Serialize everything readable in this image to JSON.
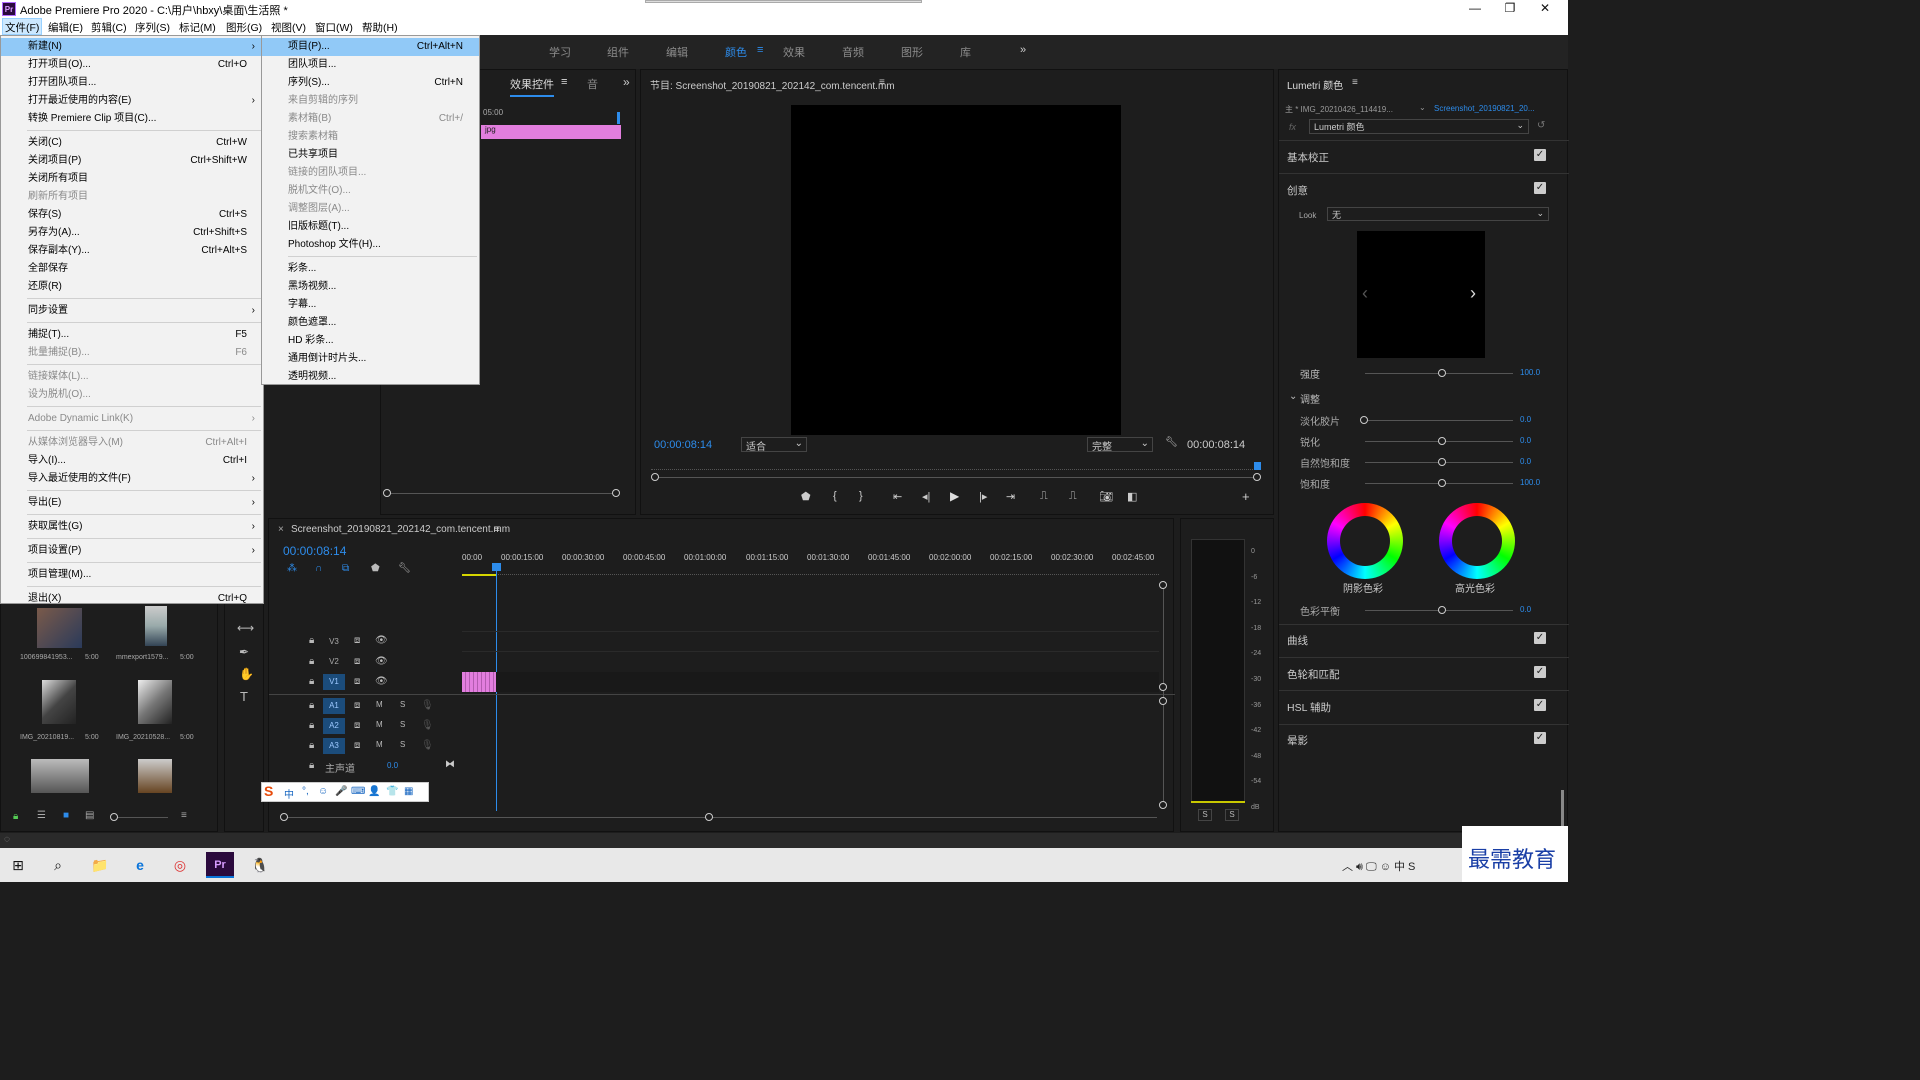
{
  "window": {
    "title": "Adobe Premiere Pro 2020 - C:\\用户\\hbxy\\桌面\\生活照 *",
    "app_icon": "Pr"
  },
  "menubar": [
    "文件(F)",
    "编辑(E)",
    "剪辑(C)",
    "序列(S)",
    "标记(M)",
    "图形(G)",
    "视图(V)",
    "窗口(W)",
    "帮助(H)"
  ],
  "workspaces": {
    "items": [
      "学习",
      "组件",
      "编辑",
      "颜色",
      "效果",
      "音频",
      "图形",
      "库"
    ],
    "active": "颜色",
    "more": "»"
  },
  "file_menu": [
    {
      "label": "新建(N)",
      "shortcut": "",
      "arrow": true,
      "disabled": false,
      "highlight": true
    },
    {
      "label": "打开项目(O)...",
      "shortcut": "Ctrl+O"
    },
    {
      "label": "打开团队项目...",
      "shortcut": ""
    },
    {
      "label": "打开最近使用的内容(E)",
      "shortcut": "",
      "arrow": true
    },
    {
      "label": "转换 Premiere Clip 项目(C)...",
      "shortcut": ""
    },
    {
      "sep": true
    },
    {
      "label": "关闭(C)",
      "shortcut": "Ctrl+W"
    },
    {
      "label": "关闭项目(P)",
      "shortcut": "Ctrl+Shift+W"
    },
    {
      "label": "关闭所有项目",
      "shortcut": ""
    },
    {
      "label": "刷新所有项目",
      "shortcut": "",
      "disabled": true
    },
    {
      "label": "保存(S)",
      "shortcut": "Ctrl+S"
    },
    {
      "label": "另存为(A)...",
      "shortcut": "Ctrl+Shift+S"
    },
    {
      "label": "保存副本(Y)...",
      "shortcut": "Ctrl+Alt+S"
    },
    {
      "label": "全部保存",
      "shortcut": ""
    },
    {
      "label": "还原(R)",
      "shortcut": ""
    },
    {
      "sep": true
    },
    {
      "label": "同步设置",
      "shortcut": "",
      "arrow": true
    },
    {
      "sep": true
    },
    {
      "label": "捕捉(T)...",
      "shortcut": "F5"
    },
    {
      "label": "批量捕捉(B)...",
      "shortcut": "F6",
      "disabled": true
    },
    {
      "sep": true
    },
    {
      "label": "链接媒体(L)...",
      "shortcut": "",
      "disabled": true
    },
    {
      "label": "设为脱机(O)...",
      "shortcut": "",
      "disabled": true
    },
    {
      "sep": true
    },
    {
      "label": "Adobe Dynamic Link(K)",
      "shortcut": "",
      "arrow": true,
      "disabled": true
    },
    {
      "sep": true
    },
    {
      "label": "从媒体浏览器导入(M)",
      "shortcut": "Ctrl+Alt+I",
      "disabled": true
    },
    {
      "label": "导入(I)...",
      "shortcut": "Ctrl+I"
    },
    {
      "label": "导入最近使用的文件(F)",
      "shortcut": "",
      "arrow": true
    },
    {
      "sep": true
    },
    {
      "label": "导出(E)",
      "shortcut": "",
      "arrow": true
    },
    {
      "sep": true
    },
    {
      "label": "获取属性(G)",
      "shortcut": "",
      "arrow": true
    },
    {
      "sep": true
    },
    {
      "label": "项目设置(P)",
      "shortcut": "",
      "arrow": true
    },
    {
      "sep": true
    },
    {
      "label": "项目管理(M)...",
      "shortcut": ""
    },
    {
      "sep": true
    },
    {
      "label": "退出(X)",
      "shortcut": "Ctrl+Q"
    }
  ],
  "new_submenu": [
    {
      "label": "项目(P)...",
      "shortcut": "Ctrl+Alt+N",
      "highlight": true
    },
    {
      "label": "团队项目...",
      "shortcut": ""
    },
    {
      "label": "序列(S)...",
      "shortcut": "Ctrl+N"
    },
    {
      "label": "来自剪辑的序列",
      "shortcut": "",
      "disabled": true
    },
    {
      "label": "素材箱(B)",
      "shortcut": "Ctrl+/",
      "disabled": true
    },
    {
      "label": "搜索素材箱",
      "shortcut": "",
      "disabled": true
    },
    {
      "label": "已共享项目",
      "shortcut": ""
    },
    {
      "label": "链接的团队项目...",
      "shortcut": "",
      "disabled": true
    },
    {
      "label": "脱机文件(O)...",
      "shortcut": "",
      "disabled": true
    },
    {
      "label": "调整图层(A)...",
      "shortcut": "",
      "disabled": true
    },
    {
      "label": "旧版标题(T)...",
      "shortcut": ""
    },
    {
      "label": "Photoshop 文件(H)...",
      "shortcut": ""
    },
    {
      "sep": true
    },
    {
      "label": "彩条...",
      "shortcut": ""
    },
    {
      "label": "黑场视频...",
      "shortcut": ""
    },
    {
      "label": "字幕...",
      "shortcut": ""
    },
    {
      "label": "颜色遮罩...",
      "shortcut": ""
    },
    {
      "label": "HD 彩条...",
      "shortcut": ""
    },
    {
      "label": "通用倒计时片头...",
      "shortcut": ""
    },
    {
      "label": "透明视频...",
      "shortcut": ""
    }
  ],
  "effect_controls": {
    "tab": "效果控件",
    "tab2": "音",
    "time": "05:00",
    "clip": "jpg"
  },
  "program_monitor": {
    "title": "节目: Screenshot_20190821_202142_com.tencent.mm",
    "timecode_left": "00:00:08:14",
    "fit": "适合",
    "quality": "完整",
    "timecode_right": "00:00:08:14"
  },
  "lumetri": {
    "title": "Lumetri 颜色",
    "master": "主 * IMG_20210426_114419...",
    "clip": "Screenshot_20190821_20...",
    "fx": "Lumetri 颜色",
    "sections": [
      "基本校正",
      "创意",
      "曲线",
      "色轮和匹配",
      "HSL 辅助",
      "晕影"
    ],
    "look_label": "Look",
    "look_value": "无",
    "intensity_label": "强度",
    "intensity_value": "100.0",
    "adjust_label": "调整",
    "sliders": [
      {
        "label": "淡化胶片",
        "value": "0.0"
      },
      {
        "label": "锐化",
        "value": "0.0"
      },
      {
        "label": "自然饱和度",
        "value": "0.0"
      },
      {
        "label": "饱和度",
        "value": "100.0"
      }
    ],
    "wheel_shadow": "阴影色彩",
    "wheel_highlight": "高光色彩",
    "balance_label": "色彩平衡",
    "balance_value": "0.0"
  },
  "timeline": {
    "title": "Screenshot_20190821_202142_com.tencent.mm",
    "timecode": "00:00:08:14",
    "ruler": [
      "00:00",
      "00:00:15:00",
      "00:00:30:00",
      "00:00:45:00",
      "00:01:00:00",
      "00:01:15:00",
      "00:01:30:00",
      "00:01:45:00",
      "00:02:00:00",
      "00:02:15:00",
      "00:02:30:00",
      "00:02:45:00"
    ],
    "video_tracks": [
      "V3",
      "V2",
      "V1"
    ],
    "audio_tracks": [
      "A1",
      "A2",
      "A3"
    ],
    "master": "主声道",
    "master_value": "0.0"
  },
  "audio_meter": {
    "scale": [
      "0",
      "-6",
      "-12",
      "-18",
      "-24",
      "-30",
      "-36",
      "-42",
      "-48",
      "-54",
      "dB"
    ],
    "solo": [
      "S",
      "S"
    ]
  },
  "project_bin": [
    {
      "name": "100699841953...",
      "dur": "5:00"
    },
    {
      "name": "mmexport1579...",
      "dur": "5:00"
    },
    {
      "name": "IMG_20210819...",
      "dur": "5:00"
    },
    {
      "name": "IMG_20210528...",
      "dur": "5:00"
    }
  ],
  "ime_bar": [
    "中",
    "°,",
    "☺",
    "🎤",
    "⌨",
    "👤",
    "👕",
    "▦"
  ],
  "watermark": "最需教育",
  "taskbar": [
    "⊞",
    "⌕",
    "📁",
    "e",
    "◎",
    "Pr",
    "🐧"
  ],
  "colors": {
    "accent": "#2d8ceb",
    "clip_pink": "#e27ede",
    "menu_highlight": "#91c9f7"
  }
}
